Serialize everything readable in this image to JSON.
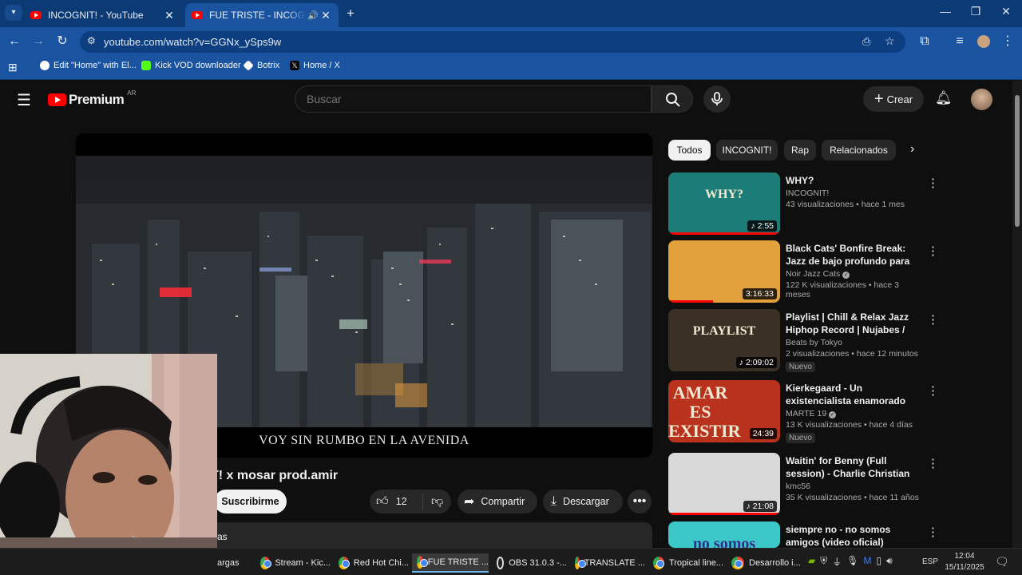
{
  "browser": {
    "tabs": [
      {
        "title": "INCOGNIT! - YouTube",
        "active": false
      },
      {
        "title": "FUE TRISTE - INCOGNIT! x mosar prod.amir",
        "active": true
      }
    ],
    "url": "youtube.com/watch?v=GGNx_ySps9w",
    "bookmarks": [
      {
        "label": "Edit \"Home\" with El...",
        "icon": "globe-icon",
        "color": "#ffffff"
      },
      {
        "label": "Kick VOD downloader",
        "icon": "kick-icon",
        "color": "#53fc18"
      },
      {
        "label": "Botrix",
        "icon": "botrix-icon",
        "color": "#ffffff"
      },
      {
        "label": "Home / X",
        "icon": "x-icon",
        "color": "#000000"
      }
    ]
  },
  "youtube": {
    "logo_text": "Premium",
    "region": "AR",
    "search_placeholder": "Buscar",
    "create_label": "Crear",
    "video": {
      "title": "T! x mosar prod.amir",
      "subtitle": "VOY SIN RUMBO EN LA AVENIDA",
      "subscribe_label": "Suscribirme",
      "like_count": "12",
      "share_label": "Compartir",
      "download_label": "Descargar",
      "description_fragment": "as"
    },
    "chips": [
      "Todos",
      "INCOGNIT!",
      "Rap",
      "Relacionados"
    ],
    "recommendations": [
      {
        "title": "WHY?",
        "channel": "INCOGNIT!",
        "verified": false,
        "views": "43 visualizaciones",
        "age": "hace 1 mes",
        "duration": "2:55",
        "music": true,
        "badge": "",
        "thumb_text": "WHY?",
        "thumb_color": "#1c7d78",
        "progress": 1.0
      },
      {
        "title": "Black Cats' Bonfire Break: Jazz de bajo profundo para trabaja...",
        "channel": "Noir Jazz Cats",
        "verified": true,
        "views": "122 K visualizaciones",
        "age": "hace 3 meses",
        "duration": "3:16:33",
        "music": false,
        "badge": "",
        "thumb_text": "",
        "thumb_color": "#e2a13a",
        "progress": 0.4
      },
      {
        "title": "Playlist | Chill & Relax Jazz Hiphop Record | Nujabes / MF...",
        "channel": "Beats by Tokyo",
        "verified": false,
        "views": "2 visualizaciones",
        "age": "hace 12 minutos",
        "duration": "2:09:02",
        "music": true,
        "badge": "Nuevo",
        "thumb_text": "PLAYLIST",
        "thumb_color": "#3a3025",
        "progress": 0.0
      },
      {
        "title": "Kierkegaard - Un existencialista enamorado",
        "channel": "MARTE 19",
        "verified": true,
        "views": "13 K visualizaciones",
        "age": "hace 4 días",
        "duration": "24:39",
        "music": false,
        "badge": "Nuevo",
        "thumb_text": "AMAR ES EXISTIR",
        "thumb_color": "#b8321e",
        "progress": 0.0
      },
      {
        "title": "Waitin' for Benny (Full session) - Charlie Christian",
        "channel": "kmc56",
        "verified": false,
        "views": "35 K visualizaciones",
        "age": "hace 11 años",
        "duration": "21:08",
        "music": true,
        "badge": "",
        "thumb_text": "",
        "thumb_color": "#d9d9d9",
        "progress": 1.0
      },
      {
        "title": "siempre no - no somos amigos (video oficial)",
        "channel": "",
        "verified": false,
        "views": "",
        "age": "",
        "duration": "",
        "music": false,
        "badge": "",
        "thumb_text": "no somos",
        "thumb_color": "#3cc8c8",
        "progress": 0.0
      }
    ]
  },
  "taskbar": {
    "items": [
      {
        "label": "argas",
        "active": false
      },
      {
        "label": "Stream - Kic...",
        "active": false
      },
      {
        "label": "Red Hot Chi...",
        "active": false
      },
      {
        "label": "FUE TRISTE ...",
        "active": true
      },
      {
        "label": "OBS 31.0.3 -...",
        "active": false
      },
      {
        "label": "TRANSLATE ...",
        "active": false
      },
      {
        "label": "Tropical line...",
        "active": false
      },
      {
        "label": "Desarrollo i...",
        "active": false
      }
    ],
    "language": "ESP",
    "time": "12:04",
    "date": "15/11/2025"
  }
}
